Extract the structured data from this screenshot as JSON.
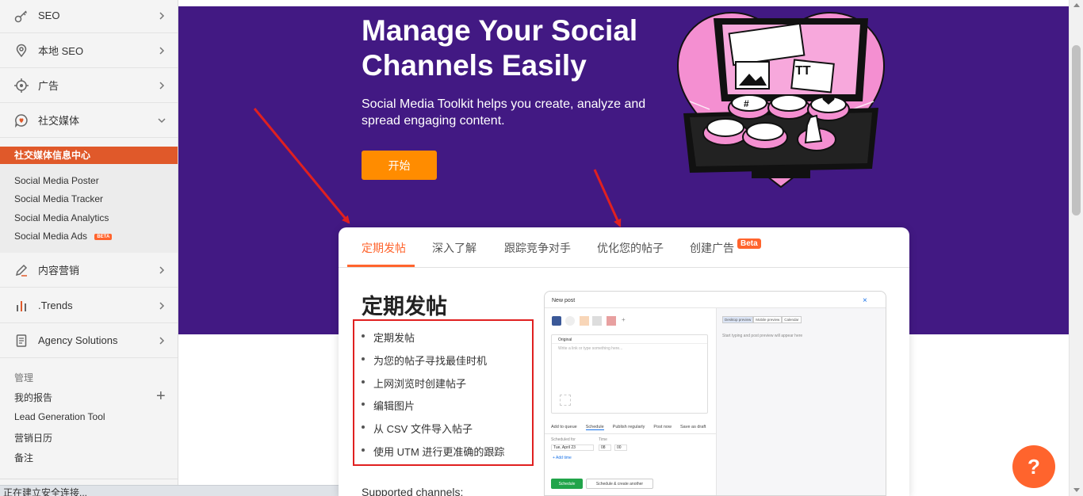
{
  "sidebar": {
    "nav": [
      {
        "label": "SEO",
        "icon": "key-icon",
        "chevron": "right"
      },
      {
        "label": "本地 SEO",
        "icon": "location-pin-icon",
        "chevron": "right"
      },
      {
        "label": "广告",
        "icon": "target-icon",
        "chevron": "right"
      },
      {
        "label": "社交媒体",
        "icon": "social-chat-icon",
        "chevron": "down"
      }
    ],
    "social_active": "社交媒体信息中心",
    "social_items": [
      "Social Media Poster",
      "Social Media Tracker",
      "Social Media Analytics",
      "Social Media Ads"
    ],
    "social_ads_badge": "BETA",
    "nav2": [
      {
        "label": "内容营销",
        "icon": "pen-icon",
        "chevron": "right"
      },
      {
        "label": ".Trends",
        "icon": "bar-chart-icon",
        "chevron": "right"
      },
      {
        "label": "Agency Solutions",
        "icon": "document-icon",
        "chevron": "right"
      }
    ],
    "management_heading": "管理",
    "management_items": [
      "我的报告",
      "Lead Generation Tool",
      "营销日历",
      "备注"
    ]
  },
  "status_bar": "正在建立安全连接...",
  "hero": {
    "title": "Manage Your Social Channels Easily",
    "subtitle": "Social Media Toolkit helps you create, analyze and spread engaging content.",
    "cta": "开始"
  },
  "card": {
    "tabs": [
      "定期发帖",
      "深入了解",
      "跟踪竞争对手",
      "优化您的帖子",
      "创建广告"
    ],
    "beta_badge": "Beta",
    "section_title": "定期发帖",
    "features": [
      "定期发帖",
      "为您的帖子寻找最佳时机",
      "上网浏览时创建帖子",
      "编辑图片",
      "从 CSV 文件导入帖子",
      "使用 UTM 进行更准确的跟踪"
    ],
    "supported_label": "Supported channels:"
  },
  "mock": {
    "title": "New post",
    "editor_label": "Original",
    "placeholder": "Write a link or type something here...",
    "preview_tabs": [
      "Desktop preview",
      "Mobile preview",
      "Calendar"
    ],
    "preview_hint": "Start typing and post preview will appear here",
    "actions": [
      "Add to queue",
      "Schedule",
      "Publish regularly",
      "Post now",
      "Save as draft"
    ],
    "scheduled_for": "Scheduled for",
    "time": "Time",
    "date_value": "Tue, April 23",
    "hour": "08",
    "minute": "00",
    "add_time": "+ Add time",
    "schedule_btn": "Schedule",
    "schedule_create_btn": "Schedule & create another",
    "close": "×"
  },
  "help": "?",
  "colors": {
    "accent": "#ff642d",
    "hero_bg": "#421983",
    "cta": "#ff8c00",
    "arrow": "#e02020"
  }
}
